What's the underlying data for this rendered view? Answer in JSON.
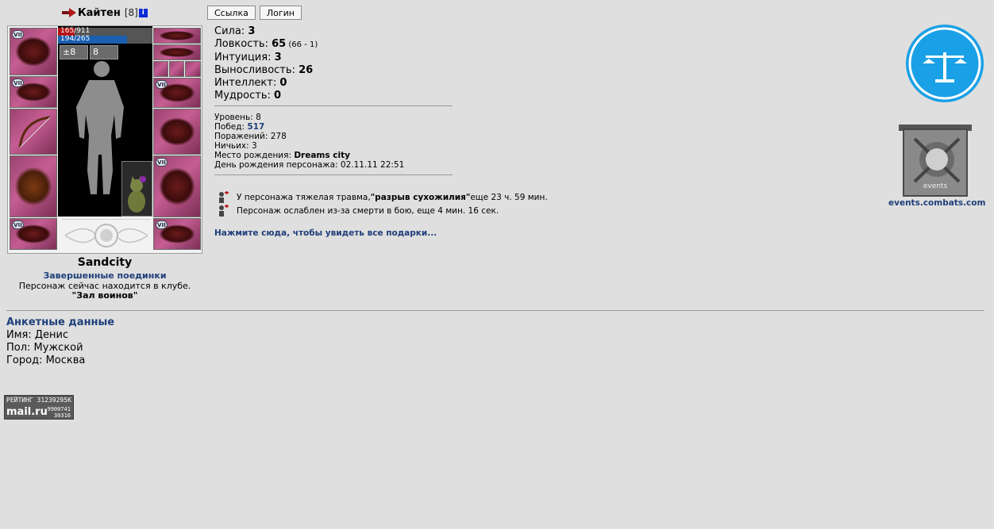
{
  "header": {
    "nickname": "Кайтен",
    "level": "[8]",
    "info_icon": "i",
    "buttons": {
      "link": "Ссылка",
      "login": "Логин"
    }
  },
  "character": {
    "hp": "165/911",
    "mp": "194/265",
    "hp_fraction": 0.18,
    "mp_fraction": 0.73,
    "buff_labels": [
      "±8",
      "8"
    ],
    "badge_text": "VII",
    "city": "Sandcity",
    "finished_fights": "Завершенные поединки",
    "club_text": "Персонаж сейчас находится в клубе.",
    "club_name": "\"Зал воинов\""
  },
  "stats": [
    {
      "label": "Сила: ",
      "value": "3",
      "extra": ""
    },
    {
      "label": "Ловкость: ",
      "value": "65",
      "extra": " (66 - 1)"
    },
    {
      "label": "Интуиция: ",
      "value": "3",
      "extra": ""
    },
    {
      "label": "Выносливость: ",
      "value": "26",
      "extra": ""
    },
    {
      "label": "Интеллект: ",
      "value": "0",
      "extra": ""
    },
    {
      "label": "Мудрость: ",
      "value": "0",
      "extra": ""
    }
  ],
  "info": {
    "level": "Уровень: 8",
    "wins_label": "Побед: ",
    "wins": "517",
    "losses": "Поражений: 278",
    "draws": "Ничьих: 3",
    "birthplace_label": "Место рождения: ",
    "birthplace": "Dreams city",
    "birthday": "День рождения персонажа: 02.11.11 22:51"
  },
  "effects": {
    "trauma_pre": "У персонажа тяжелая травма, ",
    "trauma_name": "\"разрыв сухожилия\"",
    "trauma_post": " еще 23 ч. 59 мин.",
    "weakened": "Персонаж ослаблен из-за смерти в бою, еще 4 мин. 16 сек."
  },
  "gifts_link": "Нажмите сюда, чтобы увидеть все подарки...",
  "logos": {
    "events_text": "events",
    "events_url": "events.combats.com"
  },
  "anket": {
    "title": "Анкетные данные",
    "name": "Имя: Денис",
    "sex": "Пол: Мужской",
    "city": "Город: Москва"
  },
  "rating": {
    "top": "РЕЙТИНГ 31239295К",
    "brand": "mail.ru",
    "num1": "9900741",
    "num2": "30316"
  },
  "colors": {
    "link": "#1f3f7a",
    "hp": "#b31212",
    "mp": "#1a5fb0",
    "balance": "#1aa0e6"
  }
}
